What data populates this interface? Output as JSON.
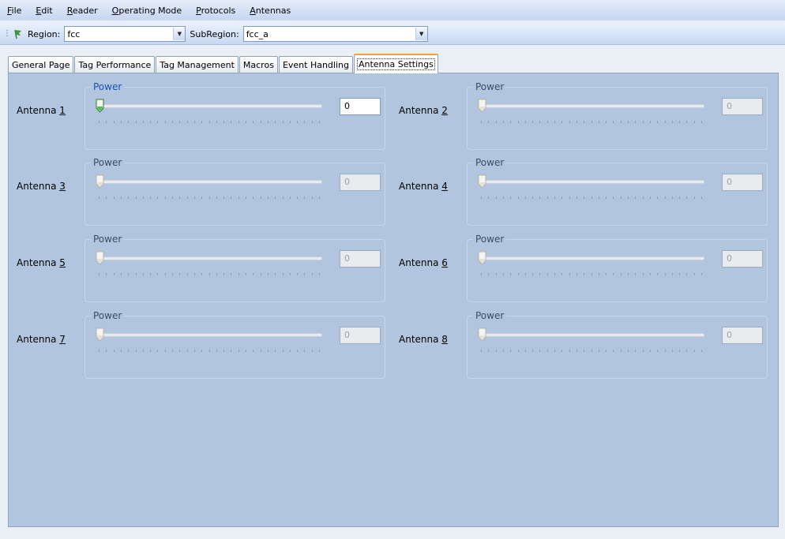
{
  "menu": [
    {
      "accel": "F",
      "rest": "ile"
    },
    {
      "accel": "E",
      "rest": "dit"
    },
    {
      "accel": "R",
      "rest": "eader"
    },
    {
      "accel": "O",
      "rest": "perating Mode"
    },
    {
      "accel": "P",
      "rest": "rotocols"
    },
    {
      "accel": "A",
      "rest": "ntennas"
    }
  ],
  "toolbar": {
    "region_label": "Region:",
    "region_value": "fcc",
    "subregion_label": "SubRegion:",
    "subregion_value": "fcc_a"
  },
  "tabs": [
    "General Page",
    "Tag Performance",
    "Tag Management",
    "Macros",
    "Event Handling",
    "Antenna Settings"
  ],
  "active_tab": "Antenna Settings",
  "antennas": [
    {
      "label": "Antenna ",
      "number": "1",
      "group_title": "Power",
      "value": "0",
      "enabled": true
    },
    {
      "label": "Antenna ",
      "number": "2",
      "group_title": "Power",
      "value": "0",
      "enabled": false
    },
    {
      "label": "Antenna ",
      "number": "3",
      "group_title": "Power",
      "value": "0",
      "enabled": false
    },
    {
      "label": "Antenna ",
      "number": "4",
      "group_title": "Power",
      "value": "0",
      "enabled": false
    },
    {
      "label": "Antenna ",
      "number": "5",
      "group_title": "Power",
      "value": "0",
      "enabled": false
    },
    {
      "label": "Antenna ",
      "number": "6",
      "group_title": "Power",
      "value": "0",
      "enabled": false
    },
    {
      "label": "Antenna ",
      "number": "7",
      "group_title": "Power",
      "value": "0",
      "enabled": false
    },
    {
      "label": "Antenna ",
      "number": "8",
      "group_title": "Power",
      "value": "0",
      "enabled": false
    }
  ],
  "colors": {
    "content_bg": "#b1c6de",
    "active_tab_accent": "#f2a52b",
    "enabled_title": "#1d4fb5"
  }
}
